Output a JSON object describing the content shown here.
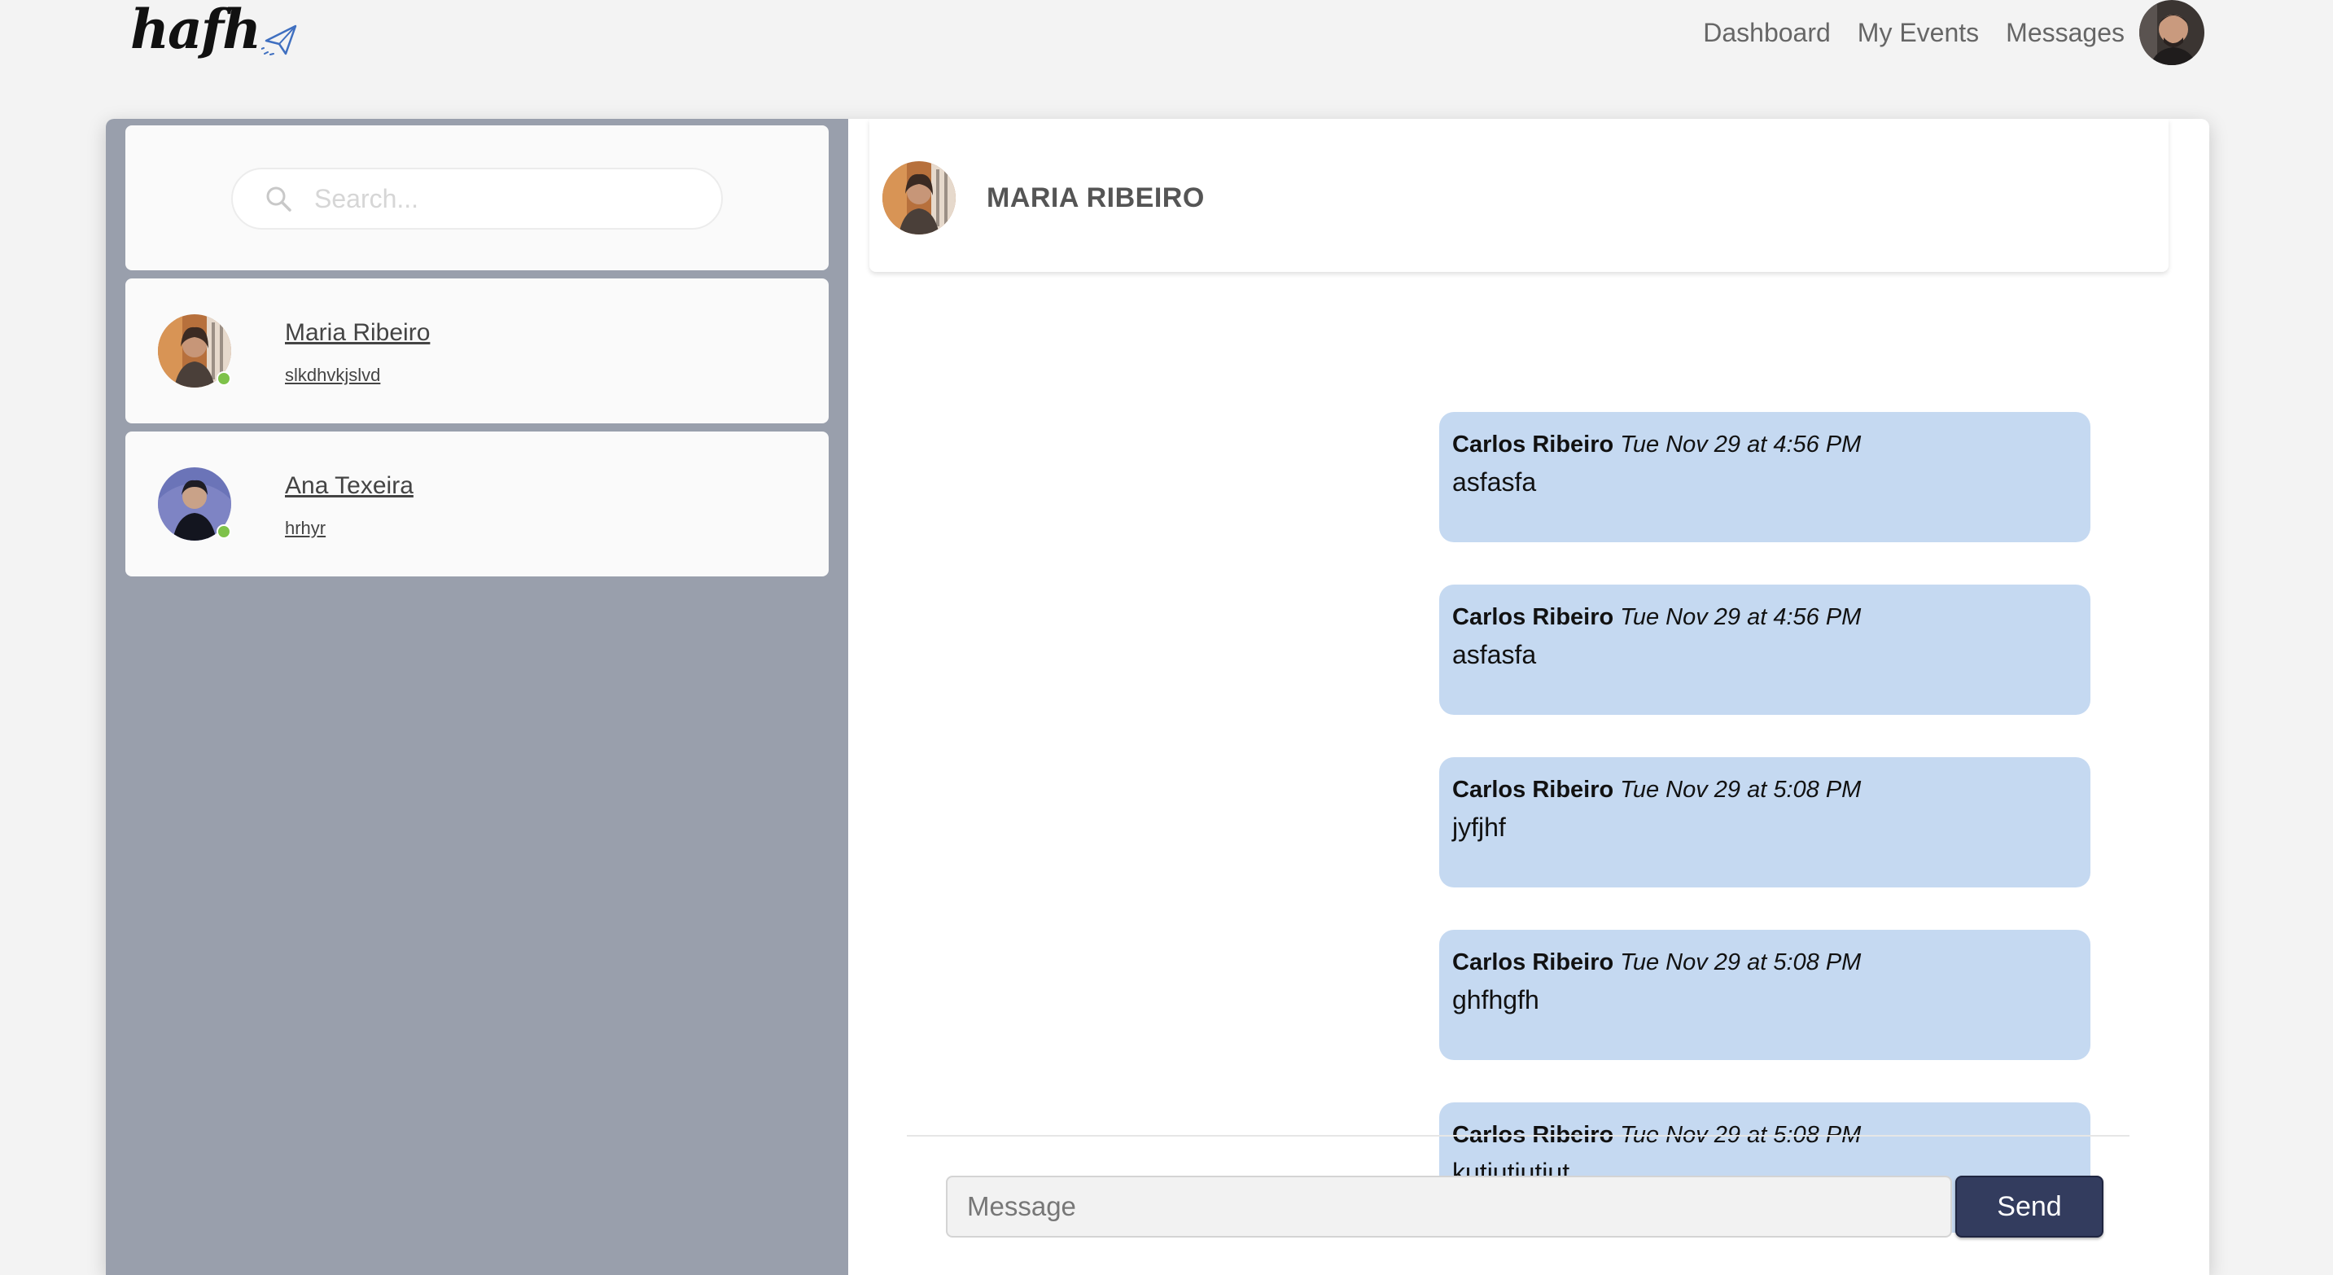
{
  "brand": {
    "logo_text": "hafh"
  },
  "nav": {
    "links": [
      {
        "label": "Dashboard"
      },
      {
        "label": "My Events"
      },
      {
        "label": "Messages"
      }
    ]
  },
  "sidebar": {
    "search": {
      "placeholder": "Search...",
      "value": ""
    },
    "conversations": [
      {
        "name": "Maria Ribeiro",
        "preview": "slkdhvkjslvd",
        "status": "online"
      },
      {
        "name": "Ana Texeira",
        "preview": "hrhyr",
        "status": "online"
      }
    ]
  },
  "chat": {
    "contact_name": "MARIA RIBEIRO",
    "messages": [
      {
        "author": "Carlos Ribeiro",
        "time": "Tue Nov 29 at 4:56 PM",
        "text": "asfasfa"
      },
      {
        "author": "Carlos Ribeiro",
        "time": "Tue Nov 29 at 4:56 PM",
        "text": "asfasfa"
      },
      {
        "author": "Carlos Ribeiro",
        "time": "Tue Nov 29 at 5:08 PM",
        "text": "jyfjhf"
      },
      {
        "author": "Carlos Ribeiro",
        "time": "Tue Nov 29 at 5:08 PM",
        "text": "ghfhgfh"
      },
      {
        "author": "Carlos Ribeiro",
        "time": "Tue Nov 29 at 5:08 PM",
        "text": "kutjutjutjut"
      }
    ],
    "composer": {
      "placeholder": "Message",
      "value": "",
      "send_label": "Send"
    }
  },
  "colors": {
    "bubble": "#c5d9f1",
    "sidebar": "#999fac",
    "send_button": "#333c5e",
    "online": "#7ec24a"
  }
}
